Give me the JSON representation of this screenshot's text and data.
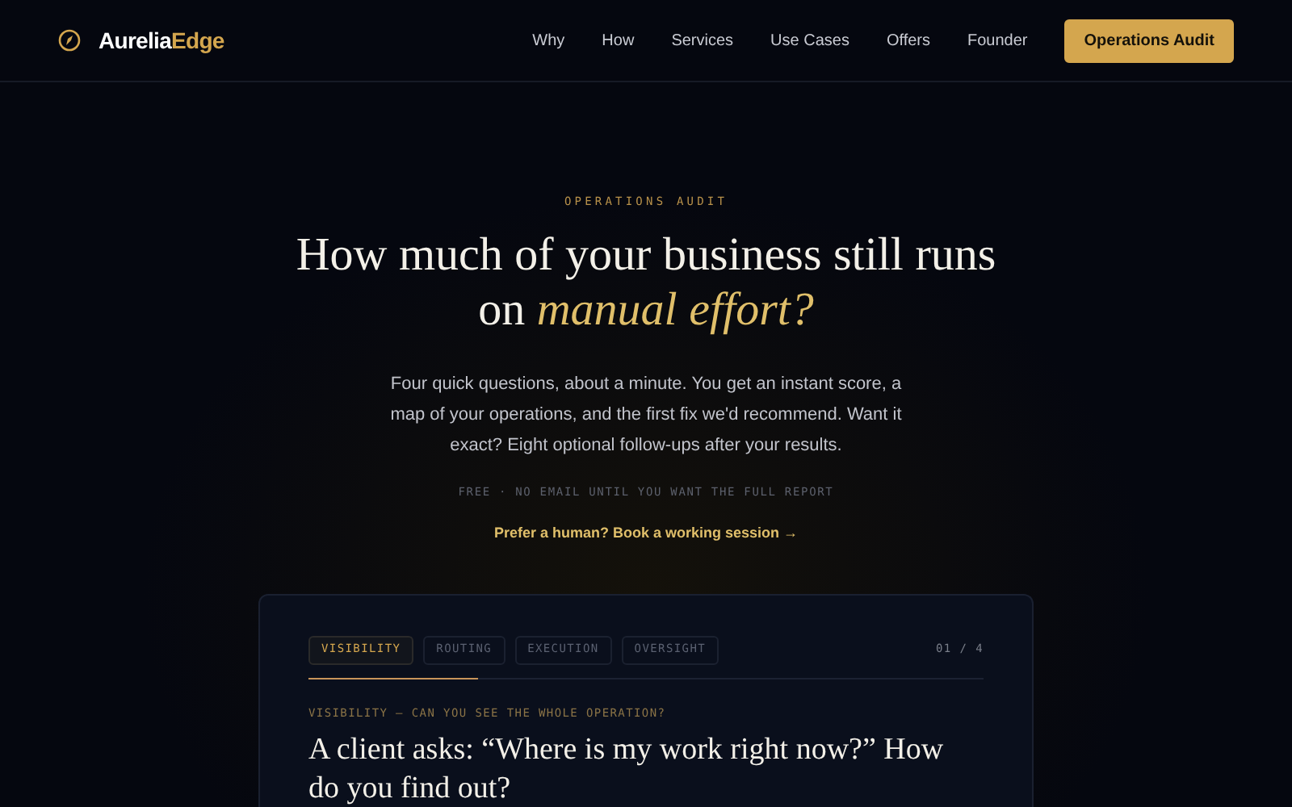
{
  "brand": {
    "first": "Aurelia",
    "second": "Edge"
  },
  "nav": {
    "links": [
      "Why",
      "How",
      "Services",
      "Use Cases",
      "Offers",
      "Founder"
    ],
    "cta": "Operations Audit"
  },
  "hero": {
    "eyebrow": "OPERATIONS AUDIT",
    "title": "How much of your business still runs on *manual effort?*",
    "intro": "Four quick questions, about a minute. You get an instant score, a map of your operations, and the first fix we'd recommend. Want it exact? Eight optional follow-ups after your results.",
    "note": "FREE · NO EMAIL UNTIL YOU WANT THE FULL REPORT",
    "link": "Prefer a human? Book a working session →"
  },
  "quiz": {
    "tabs": [
      {
        "label": "VISIBILITY",
        "selected": true
      },
      {
        "label": "ROUTING",
        "selected": false
      },
      {
        "label": "EXECUTION",
        "selected": false
      },
      {
        "label": "OVERSIGHT",
        "selected": false
      }
    ],
    "counter": "01 / 4",
    "progress": {
      "level": 0.25
    },
    "category": "VISIBILITY — CAN YOU SEE THE WHOLE OPERATION?",
    "question": "A client asks: “Where is my work right now?” How do you find out?"
  }
}
